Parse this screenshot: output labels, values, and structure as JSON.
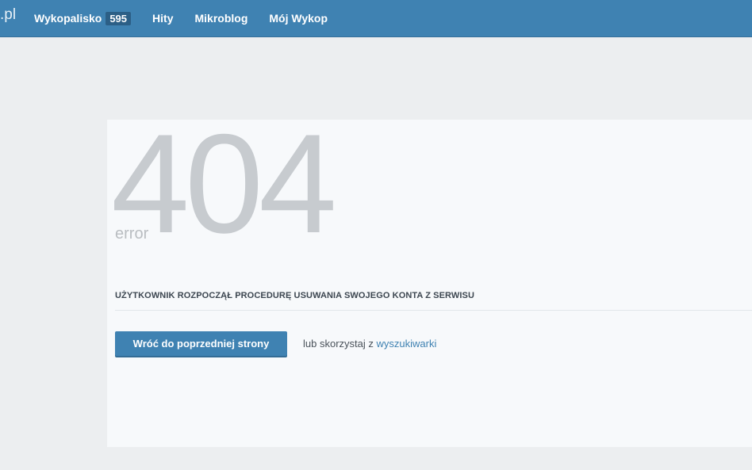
{
  "header": {
    "logo_fragment": ".pl",
    "nav": [
      {
        "label": "Wykopalisko",
        "badge": "595"
      },
      {
        "label": "Hity"
      },
      {
        "label": "Mikroblog"
      },
      {
        "label": "Mój Wykop"
      }
    ]
  },
  "error": {
    "code": "404",
    "word": "error",
    "message": "UŻYTKOWNIK ROZPOCZĄŁ PROCEDURĘ USUWANIA SWOJEGO KONTA Z SERWISU",
    "back_button": "Wróć do poprzedniej strony",
    "alt_prefix": "lub skorzystaj z ",
    "alt_link": "wyszukiwarki"
  },
  "colors": {
    "topbar": "#3f82b2",
    "button": "#3f82b2",
    "link": "#3f82b2"
  }
}
